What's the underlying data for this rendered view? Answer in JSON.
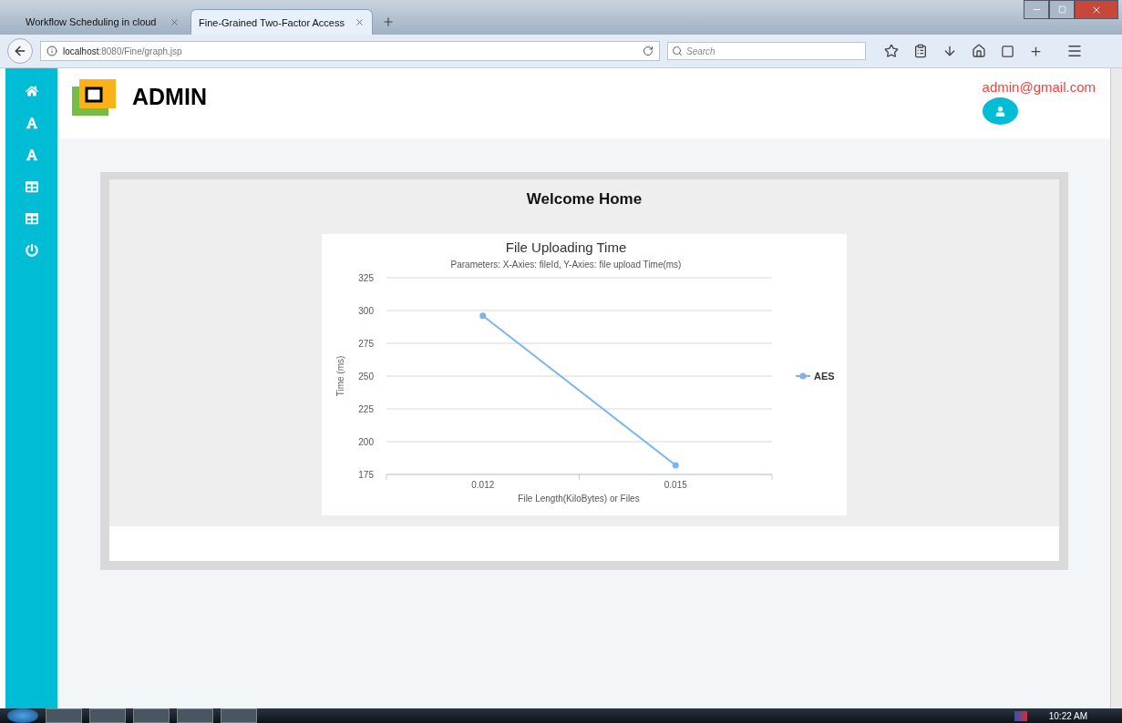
{
  "browser": {
    "tabs": [
      {
        "title": "Workflow Scheduling in cloud",
        "selected": false
      },
      {
        "title": "Fine-Grained Two-Factor Access",
        "selected": true
      }
    ],
    "address": {
      "host": "localhost",
      "path": ":8080/Fine/graph.jsp"
    },
    "search": {
      "placeholder": "Search"
    }
  },
  "header": {
    "title": "ADMIN",
    "email": "admin@gmail.com"
  },
  "panel": {
    "heading": "Welcome Home",
    "chart_data": {
      "type": "line",
      "title": "File Uploading Time",
      "subtitle": "Parameters: X-Axies: fileId, Y-Axies: file upload Time(ms)",
      "xlabel": "File Length(KiloBytes) or Files",
      "ylabel": "Time (ms)",
      "categories": [
        "0.012",
        "0.015"
      ],
      "series": [
        {
          "name": "AES",
          "color": "#7cb5ec",
          "values": [
            296,
            182
          ]
        }
      ],
      "ylim": [
        175,
        325
      ],
      "grid": true,
      "marker": true,
      "yticks": [
        175,
        200,
        225,
        250,
        275,
        300,
        325
      ]
    }
  },
  "taskbar": {
    "time": "10:22 AM"
  }
}
